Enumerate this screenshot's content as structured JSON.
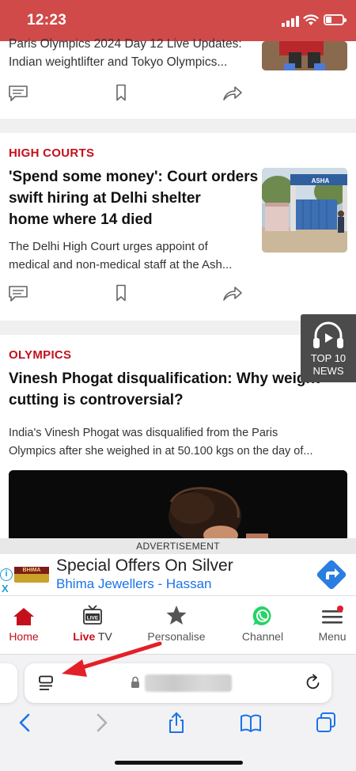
{
  "status_bar": {
    "time": "12:23"
  },
  "articles": [
    {
      "category": "",
      "headline": "",
      "summary_lines": [
        "Paris Olympics 2024 Day 12 Live Updates:",
        "Indian weightlifter and Tokyo Olympics..."
      ]
    },
    {
      "category": "HIGH COURTS",
      "headline_lines": [
        "'Spend some money': Court orders",
        "swift hiring at Delhi shelter",
        "home where 14 died"
      ],
      "summary_lines": [
        "The Delhi High Court urges appoint of",
        "medical and non-medical staff at the Ash..."
      ],
      "thumb_sign": "ASHA"
    },
    {
      "category": "OLYMPICS",
      "headline_lines": [
        "Vinesh Phogat disqualification: Why weight",
        "cutting is controversial?"
      ],
      "summary_lines": [
        "India's Vinesh Phogat was disqualified from the Paris",
        "Olympics after she weighed in at 50.100 kgs on the day of..."
      ]
    }
  ],
  "top10": {
    "line1": "TOP 10",
    "line2": "NEWS"
  },
  "ad": {
    "label": "ADVERTISEMENT",
    "title": "Special Offers On Silver",
    "subtitle": "Bhima Jewellers - Hassan",
    "logo_text": "BHIMA",
    "info": "i",
    "close": "X"
  },
  "bottom_nav": {
    "home": "Home",
    "live_a": "Live",
    "live_b": " TV",
    "live_icon": "LIVE",
    "personalise": "Personalise",
    "channel": "Channel",
    "menu": "Menu"
  },
  "colors": {
    "brand_red": "#c4101b",
    "status_bar": "#d04a4a",
    "ios_blue": "#1a73e8"
  }
}
